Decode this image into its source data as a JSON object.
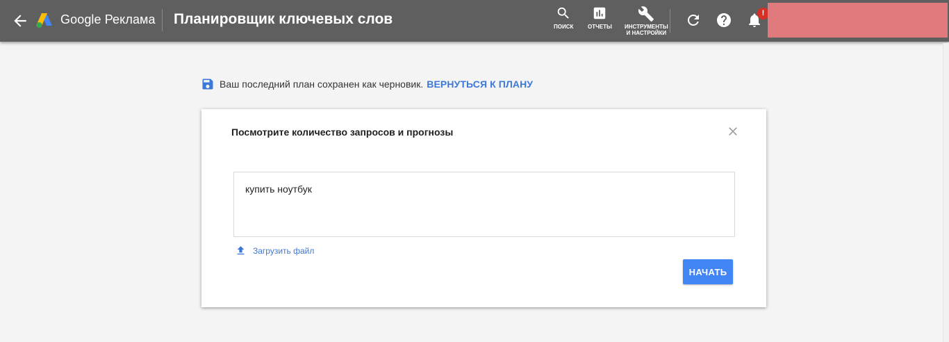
{
  "header": {
    "brand": "Google Реклама",
    "page_title": "Планировщик ключевых слов",
    "tools": [
      {
        "label": "ПОИСК",
        "icon": "search-icon"
      },
      {
        "label": "ОТЧЕТЫ",
        "icon": "reports-icon"
      },
      {
        "label_line1": "ИНСТРУМЕНТЫ",
        "label_line2": "И НАСТРОЙКИ",
        "icon": "wrench-icon"
      }
    ],
    "notification_badge": "!",
    "colors": {
      "bar": "#5f5f5f",
      "account_block": "#e07a7d",
      "badge": "#d93025"
    }
  },
  "draft_notice": {
    "text": "Ваш последний план сохранен как черновик.",
    "link": "ВЕРНУТЬСЯ К ПЛАНУ",
    "link_color": "#3c78d8"
  },
  "card": {
    "title": "Посмотрите количество запросов и прогнозы",
    "keyword_value": "купить ноутбук",
    "upload_label": "Загрузить файл",
    "start_button": "НАЧАТЬ",
    "button_color": "#4285f4"
  }
}
